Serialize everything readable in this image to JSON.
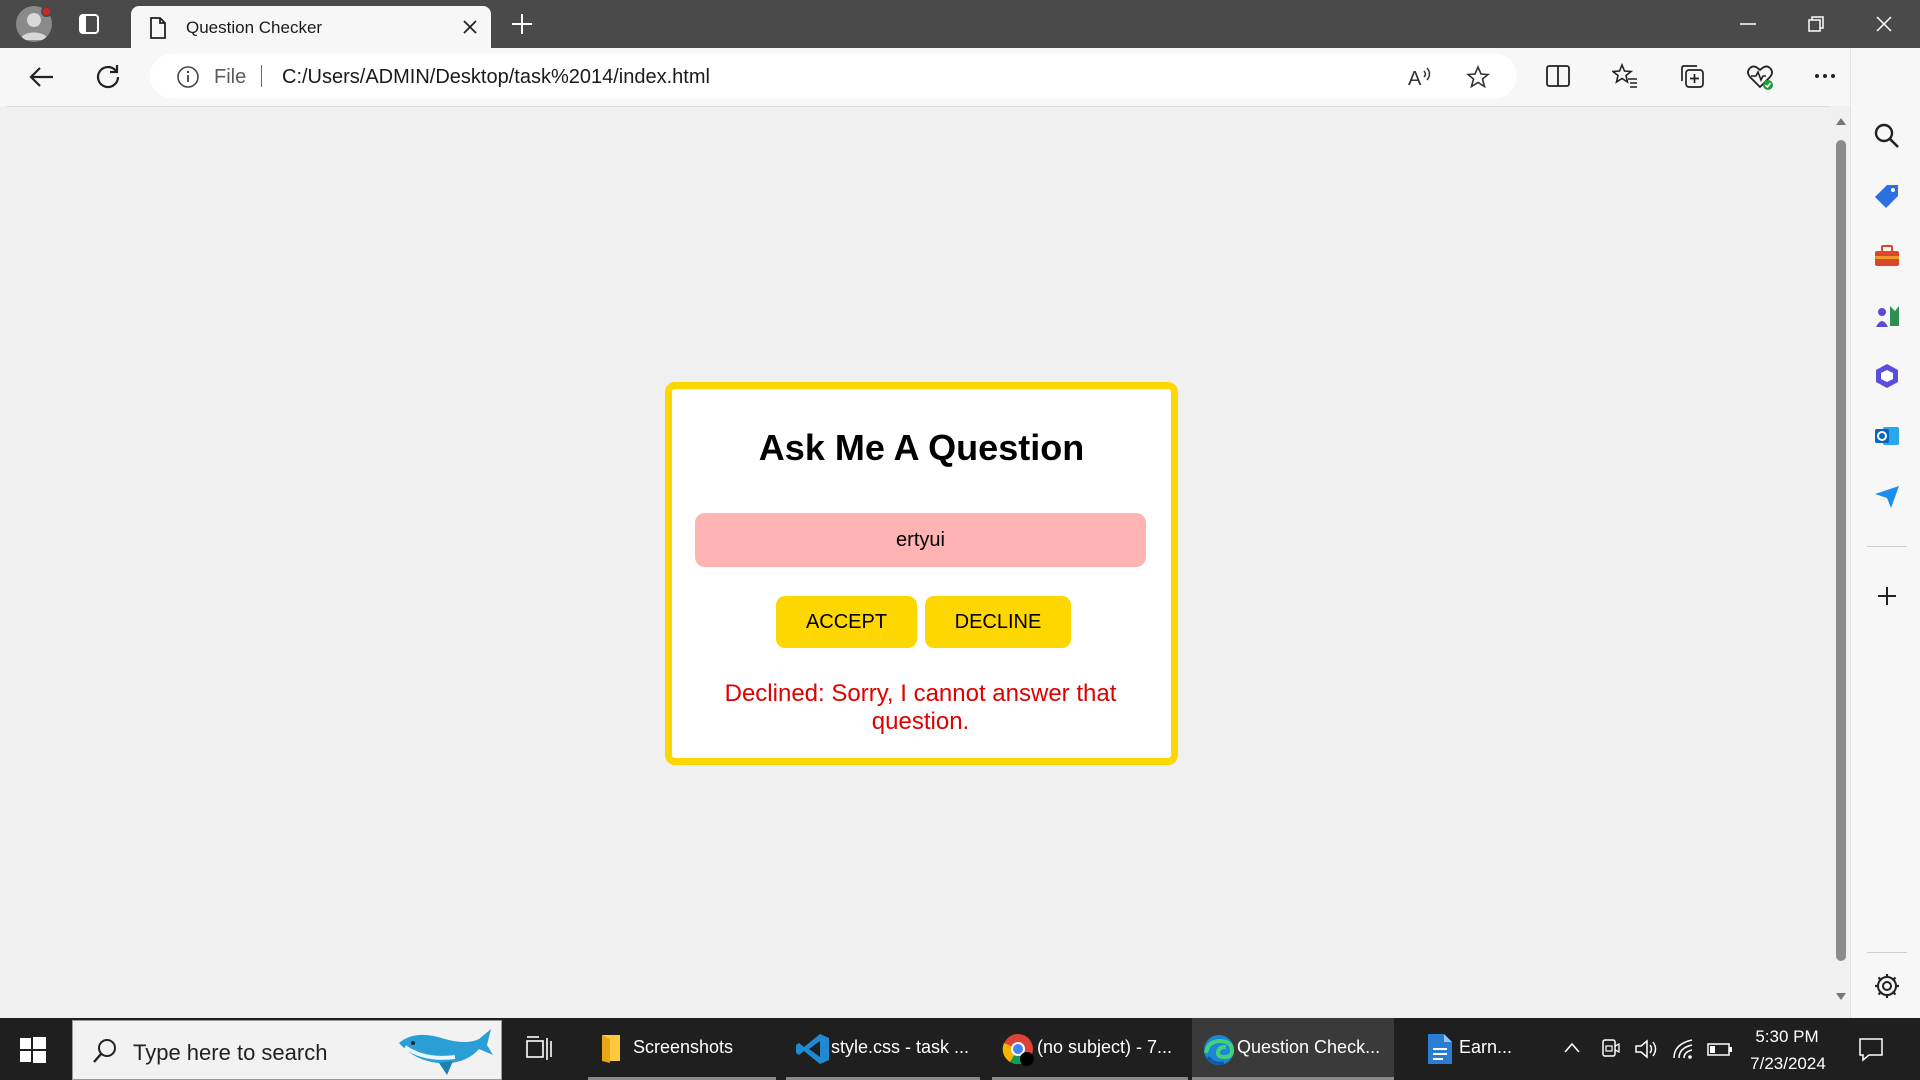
{
  "browser": {
    "tab_title": "Question Checker",
    "address": {
      "scheme_label": "File",
      "url": "C:/Users/ADMIN/Desktop/task%2014/index.html"
    }
  },
  "page": {
    "heading": "Ask Me A Question",
    "question_value": "ertyui",
    "accept_label": "ACCEPT",
    "decline_label": "DECLINE",
    "result_message": "Declined: Sorry, I cannot answer that question."
  },
  "taskbar": {
    "search_placeholder": "Type here to search",
    "apps": [
      {
        "label": "Screenshots",
        "icon": "folder-icon"
      },
      {
        "label": "style.css - task ...",
        "icon": "vscode-icon"
      },
      {
        "label": "(no subject) - 7...",
        "icon": "chrome-icon"
      },
      {
        "label": "Question Check...",
        "icon": "edge-icon"
      },
      {
        "label": "Earn...",
        "icon": "document-icon"
      }
    ],
    "clock": {
      "time": "5:30 PM",
      "date": "7/23/2024"
    }
  },
  "colors": {
    "card_border": "#ffd700",
    "buttons": "#ffd700",
    "input_background": "#ffb3b3",
    "result_text": "#e00000",
    "titlebar": "#4a4a4a",
    "taskbar": "#1f1f1f"
  }
}
